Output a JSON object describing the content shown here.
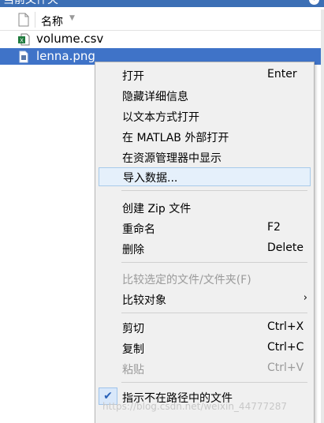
{
  "window": {
    "title": "当前文件夹"
  },
  "header": {
    "name_col": "名称"
  },
  "files": [
    {
      "name": "volume.csv",
      "icon": "csv-file-icon"
    },
    {
      "name": "lenna.png",
      "icon": "image-file-icon",
      "selected": true
    }
  ],
  "menu": {
    "open": {
      "label": "打开",
      "accel": "Enter"
    },
    "hide_details": {
      "label": "隐藏详细信息"
    },
    "open_as_text": {
      "label": "以文本方式打开"
    },
    "open_outside": {
      "label": "在 MATLAB 外部打开"
    },
    "show_in_explorer": {
      "label": "在资源管理器中显示"
    },
    "import_data": {
      "label": "导入数据..."
    },
    "create_zip": {
      "label": "创建 Zip 文件"
    },
    "rename": {
      "label": "重命名",
      "accel": "F2"
    },
    "delete": {
      "label": "删除",
      "accel": "Delete"
    },
    "compare_selected": {
      "label": "比较选定的文件/文件夹(F)"
    },
    "compare_to": {
      "label": "比较对象"
    },
    "cut": {
      "label": "剪切",
      "accel": "Ctrl+X"
    },
    "copy": {
      "label": "复制",
      "accel": "Ctrl+C"
    },
    "paste": {
      "label": "粘贴",
      "accel": "Ctrl+V"
    },
    "show_not_in_path": {
      "label": "指示不在路径中的文件",
      "checked": true
    }
  },
  "watermark": "https://blog.csdn.net/weixin_44777287",
  "colors": {
    "selection": "#3f73c8",
    "menu_bg": "#f0f0f0",
    "highlight": "#e5f0fb"
  }
}
